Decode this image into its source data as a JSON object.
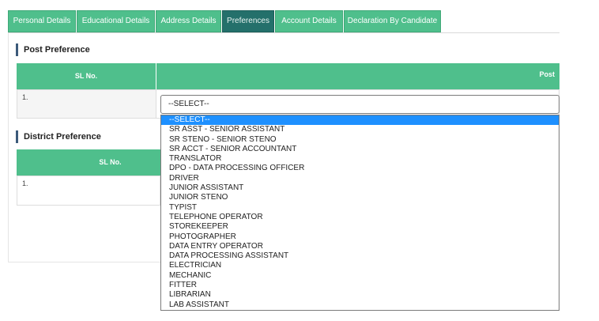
{
  "tabs": [
    {
      "label": "Personal Details",
      "active": false
    },
    {
      "label": "Educational Details",
      "active": false
    },
    {
      "label": "Address Details",
      "active": false
    },
    {
      "label": "Preferences",
      "active": true
    },
    {
      "label": "Account Details",
      "active": false
    },
    {
      "label": "Declaration By Candidate",
      "active": false
    }
  ],
  "post_section": {
    "title": "Post Preference",
    "col_sl": "SL No.",
    "col_post": "Post",
    "row_sl": "1.",
    "select_value": "--SELECT--"
  },
  "district_section": {
    "title": "District Preference",
    "col_sl": "SL No.",
    "row_sl": "1."
  },
  "dropdown": {
    "highlighted_index": 0,
    "options": [
      "--SELECT--",
      "SR ASST - SENIOR ASSISTANT",
      "SR STENO - SENIOR STENO",
      "SR ACCT - SENIOR ACCOUNTANT",
      "TRANSLATOR",
      "DPO - DATA PROCESSING OFFICER",
      "DRIVER",
      "JUNIOR ASSISTANT",
      "JUNIOR STENO",
      "TYPIST",
      "TELEPHONE OPERATOR",
      "STOREKEEPER",
      "PHOTOGRAPHER",
      "DATA ENTRY OPERATOR",
      "DATA PROCESSING ASSISTANT",
      "ELECTRICIAN",
      "MECHANIC",
      "FITTER",
      "LIBRARIAN",
      "LAB ASSISTANT"
    ]
  },
  "colors": {
    "tab_bg": "#4fbf8c",
    "tab_active_bg": "#24706b",
    "table_header_bg": "#4fbf8c",
    "option_highlight": "#1e90ff"
  }
}
